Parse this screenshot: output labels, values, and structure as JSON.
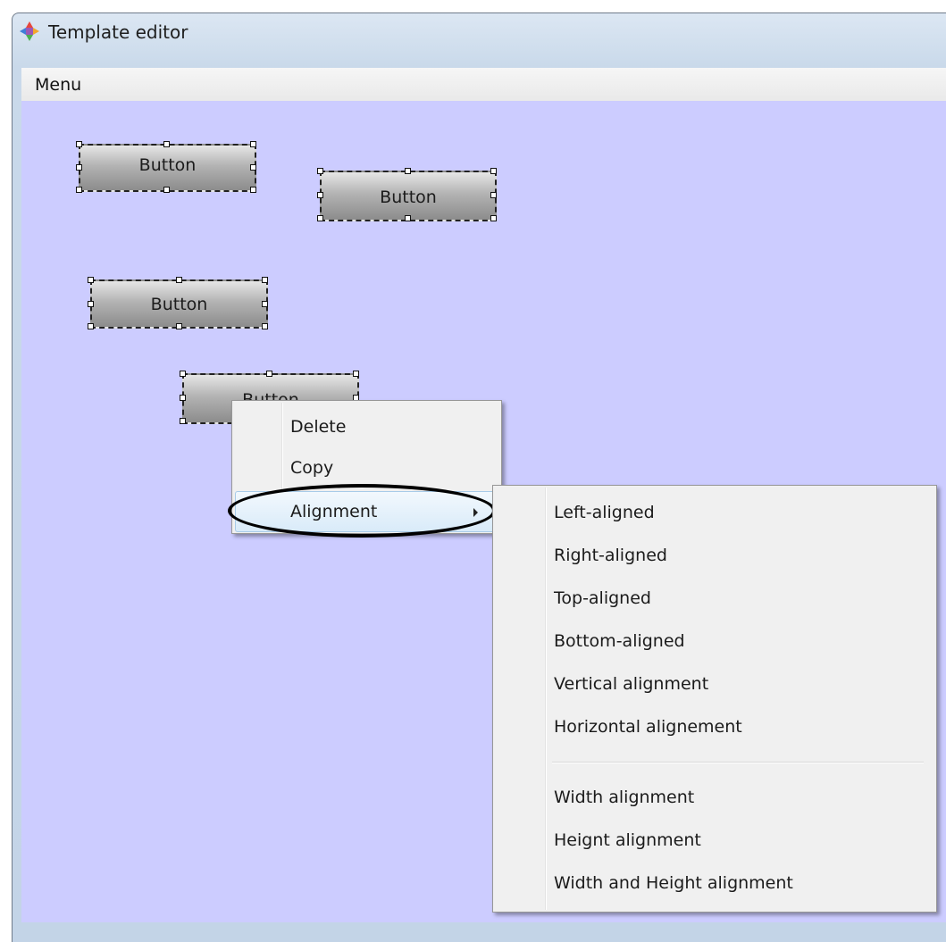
{
  "window": {
    "title": "Template editor",
    "app_icon": "colorful-cube-icon"
  },
  "menubar": {
    "menu_label": "Menu"
  },
  "canvas": {
    "background": "#ccccff",
    "buttons": [
      {
        "label": "Button"
      },
      {
        "label": "Button"
      },
      {
        "label": "Button"
      },
      {
        "label": "Button"
      }
    ]
  },
  "context_menu": {
    "items": [
      {
        "label": "Delete"
      },
      {
        "label": "Copy"
      },
      {
        "label": "Alignment",
        "has_submenu": true,
        "highlighted": true
      }
    ]
  },
  "alignment_submenu": {
    "group1": [
      "Left-aligned",
      "Right-aligned",
      "Top-aligned",
      "Bottom-aligned",
      "Vertical alignment",
      "Horizontal alignement"
    ],
    "group2": [
      "Width alignment",
      "Heignt alignment",
      "Width and Height alignment"
    ]
  }
}
